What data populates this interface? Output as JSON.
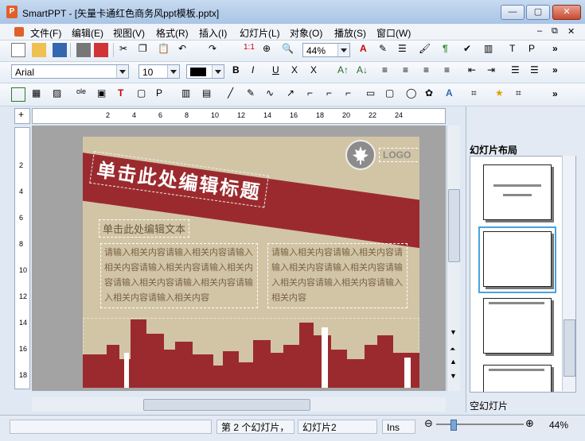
{
  "window": {
    "app_name": "SmartPPT",
    "title": "SmartPPT - [矢量卡通红色商务风ppt模板.pptx]"
  },
  "menu": [
    "文件(F)",
    "编辑(E)",
    "视图(V)",
    "格式(R)",
    "插入(I)",
    "幻灯片(L)",
    "对象(O)",
    "播放(S)",
    "窗口(W)"
  ],
  "toolbar1": {
    "zoom_value": "44%"
  },
  "toolbar2": {
    "font_name": "Arial",
    "font_size": "10"
  },
  "rulers": {
    "h_ticks": [
      "2",
      "4",
      "6",
      "8",
      "10",
      "12",
      "14",
      "16",
      "18",
      "20",
      "22",
      "24"
    ],
    "v_ticks": [
      "2",
      "4",
      "6",
      "8",
      "10",
      "12",
      "14",
      "16",
      "18"
    ]
  },
  "slide": {
    "title": "单击此处编辑标题",
    "logo": "LOGO",
    "subtitle": "单击此处编辑文本",
    "body_left": "请输入相关内容请输入相关内容请输入相关内容请输入相关内容请输入相关内容请输入相关内容请输入相关内容请输入相关内容请输入相关内容",
    "body_right": "请输入相关内容请输入相关内容请输入相关内容请输入相关内容请输入相关内容请输入相关内容请输入相关内容"
  },
  "right_panel": {
    "title": "幻灯片布局",
    "selected_layout": "空幻灯片"
  },
  "status": {
    "slide_position": "第 2 个幻灯片，",
    "slide_name": "幻灯片2",
    "mode": "Ins",
    "zoom": "44%",
    "zoom_level": 0.44
  },
  "colors": {
    "accent_red": "#9b2a2e",
    "slide_bg": "#d2c5a6"
  }
}
